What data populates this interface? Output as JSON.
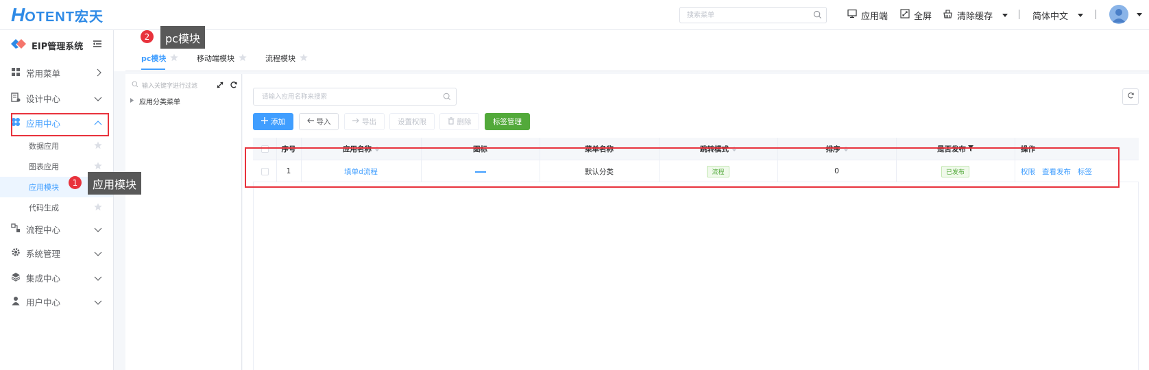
{
  "header": {
    "logo_mark": "H",
    "logo_text": "OTENT宏天",
    "search_placeholder": "搜索菜单",
    "app_label": "应用端",
    "fullscreen_label": "全屏",
    "clear_cache_label": "清除缓存",
    "language_label": "简体中文"
  },
  "sidebar": {
    "title": "EIP管理系统",
    "menus": [
      {
        "label": "常用菜单",
        "icon": "grid-icon"
      },
      {
        "label": "设计中心",
        "icon": "design-icon"
      },
      {
        "label": "应用中心",
        "icon": "apps-icon"
      },
      {
        "label": "流程中心",
        "icon": "flow-icon"
      },
      {
        "label": "系统管理",
        "icon": "gear-icon"
      },
      {
        "label": "集成中心",
        "icon": "layers-icon"
      },
      {
        "label": "用户中心",
        "icon": "user-icon"
      }
    ],
    "submenus": [
      {
        "label": "数据应用"
      },
      {
        "label": "图表应用"
      },
      {
        "label": "应用模块"
      },
      {
        "label": "代码生成"
      }
    ]
  },
  "tabs": [
    {
      "label": "pc模块"
    },
    {
      "label": "移动端模块"
    },
    {
      "label": "流程模块"
    }
  ],
  "tree": {
    "filter_placeholder": "输入关键字进行过滤",
    "root_label": "应用分类菜单"
  },
  "main": {
    "search_placeholder": "请输入应用名称来搜索",
    "buttons": {
      "add": "添加",
      "import": "导入",
      "export": "导出",
      "permission": "设置权限",
      "delete": "删除",
      "tag_manage": "标签管理"
    },
    "table": {
      "headers": [
        "序号",
        "应用名称",
        "图标",
        "菜单名称",
        "跳转模式",
        "排序",
        "是否发布",
        "操作"
      ],
      "rows": [
        {
          "index": "1",
          "name": "填单d流程",
          "icon": "—",
          "menu": "默认分类",
          "mode": "流程",
          "sort": "0",
          "published": "已发布",
          "actions": [
            "权限",
            "查看发布",
            "标签"
          ]
        }
      ]
    }
  },
  "annotations": {
    "marker1": "1",
    "tooltip1": "应用模块",
    "marker2": "2",
    "tooltip2": "pc模块"
  },
  "colors": {
    "primary": "#409eff",
    "success": "#52a93a",
    "annotation_red": "#e8323c",
    "logo_blue": "#2e8ae6"
  }
}
